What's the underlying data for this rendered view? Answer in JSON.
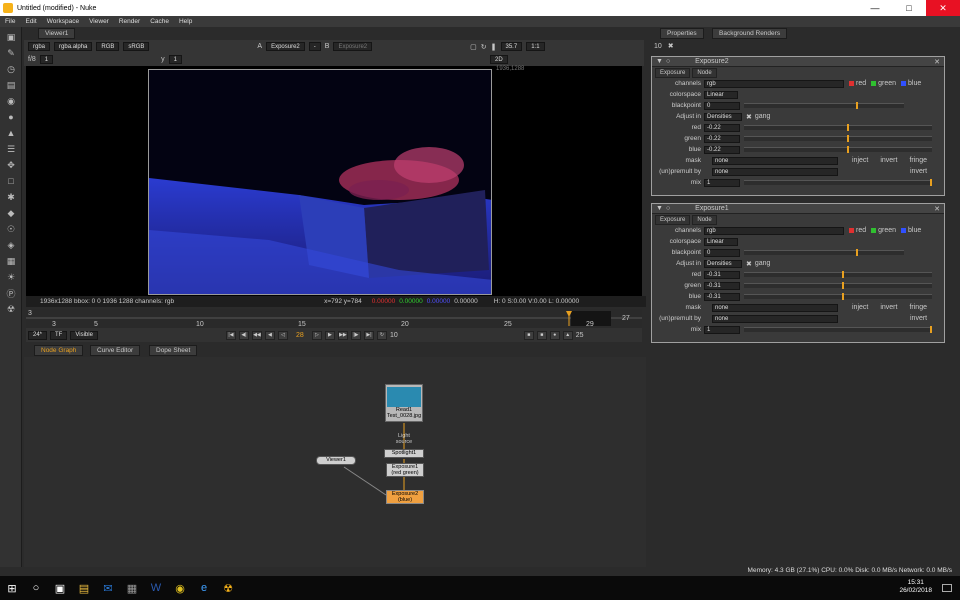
{
  "window": {
    "title": "Untitled (modified) - Nuke"
  },
  "menu": [
    "File",
    "Edit",
    "Workspace",
    "Viewer",
    "Render",
    "Cache",
    "Help"
  ],
  "viewer": {
    "tab": "Viewer1",
    "channels": "rgba",
    "alpha": "rgba.alpha",
    "display": "RGB",
    "lut": "sRGB",
    "input_a_label": "A",
    "input_a": "Exposure2",
    "input_sep": "-",
    "input_b_label": "B",
    "input_b": "Exposure2",
    "zoom": "35.7",
    "ratio": "1:1",
    "view_mode": "2D",
    "gain": "f/8",
    "frame_step": "1",
    "gamma_label": "y",
    "gamma": "1",
    "res_label": "1936,1288",
    "info_format": "1936x1288  bbox: 0 0 1936 1288 channels: rgb",
    "info_coords": "x=792 y=784",
    "info_r": "0.00000",
    "info_g": "0.00000",
    "info_b": "0.00000",
    "info_a": "0.00000",
    "info_hsvl": "H: 0 S:0.00 V:0.00   L: 0.00000"
  },
  "timeline": {
    "start": "3",
    "end": "27",
    "ticks": [
      "3",
      "5",
      "10",
      "15",
      "20",
      "25",
      "29"
    ],
    "current_frame": "28",
    "fps": "24*",
    "tf": "TF",
    "visibility": "Visible",
    "step": "10",
    "out_frame": "25"
  },
  "graph_tabs": [
    "Node Graph",
    "Curve Editor",
    "Dope Sheet"
  ],
  "nodes": {
    "read": "Read1\nTest_0028.jpg",
    "light_label": "Light\nsource",
    "spotlight": "Spotlight1",
    "viewer": "Viewer1",
    "exposure1": "Exposure1\n(red green)",
    "exposure2": "Exposure2\n(blue)"
  },
  "props": {
    "tabs": [
      "Properties",
      "Background Renders"
    ],
    "max_panels": "10",
    "panels": [
      {
        "name": "Exposure2",
        "tabs": [
          "Exposure",
          "Node"
        ],
        "channels": "rgb",
        "ch_red": "red",
        "ch_green": "green",
        "ch_blue": "blue",
        "colorspace": "Linear",
        "blackpoint": "0",
        "adjust_in": "Densities",
        "gang": "gang",
        "red": "-0.22",
        "green": "-0.22",
        "blue": "-0.22",
        "mask": "none",
        "inject": "inject",
        "invert": "invert",
        "fringe": "fringe",
        "premult": "none",
        "invert2": "invert",
        "mix": "1"
      },
      {
        "name": "Exposure1",
        "tabs": [
          "Exposure",
          "Node"
        ],
        "channels": "rgb",
        "ch_red": "red",
        "ch_green": "green",
        "ch_blue": "blue",
        "colorspace": "Linear",
        "blackpoint": "0",
        "adjust_in": "Densities",
        "gang": "gang",
        "red": "-0.31",
        "green": "-0.31",
        "blue": "-0.31",
        "mask": "none",
        "inject": "inject",
        "invert": "invert",
        "fringe": "fringe",
        "premult": "none",
        "invert2": "invert",
        "mix": "1"
      }
    ],
    "labels": {
      "channels": "channels",
      "colorspace": "colorspace",
      "blackpoint": "blackpoint",
      "adjust_in": "Adjust in",
      "red": "red",
      "green": "green",
      "blue": "blue",
      "mask": "mask",
      "premult": "(un)premult by",
      "mix": "mix"
    }
  },
  "status": "Memory: 4.3 GB (27.1%)  CPU: 0.0%  Disk: 0.0 MB/s  Network: 0.0 MB/s",
  "taskbar": {
    "time": "15:31",
    "date": "26/02/2018"
  },
  "colors": {
    "accent": "#e8a020",
    "node_read": "#b8b8b8",
    "node_exposure_sel": "#f0a040"
  }
}
